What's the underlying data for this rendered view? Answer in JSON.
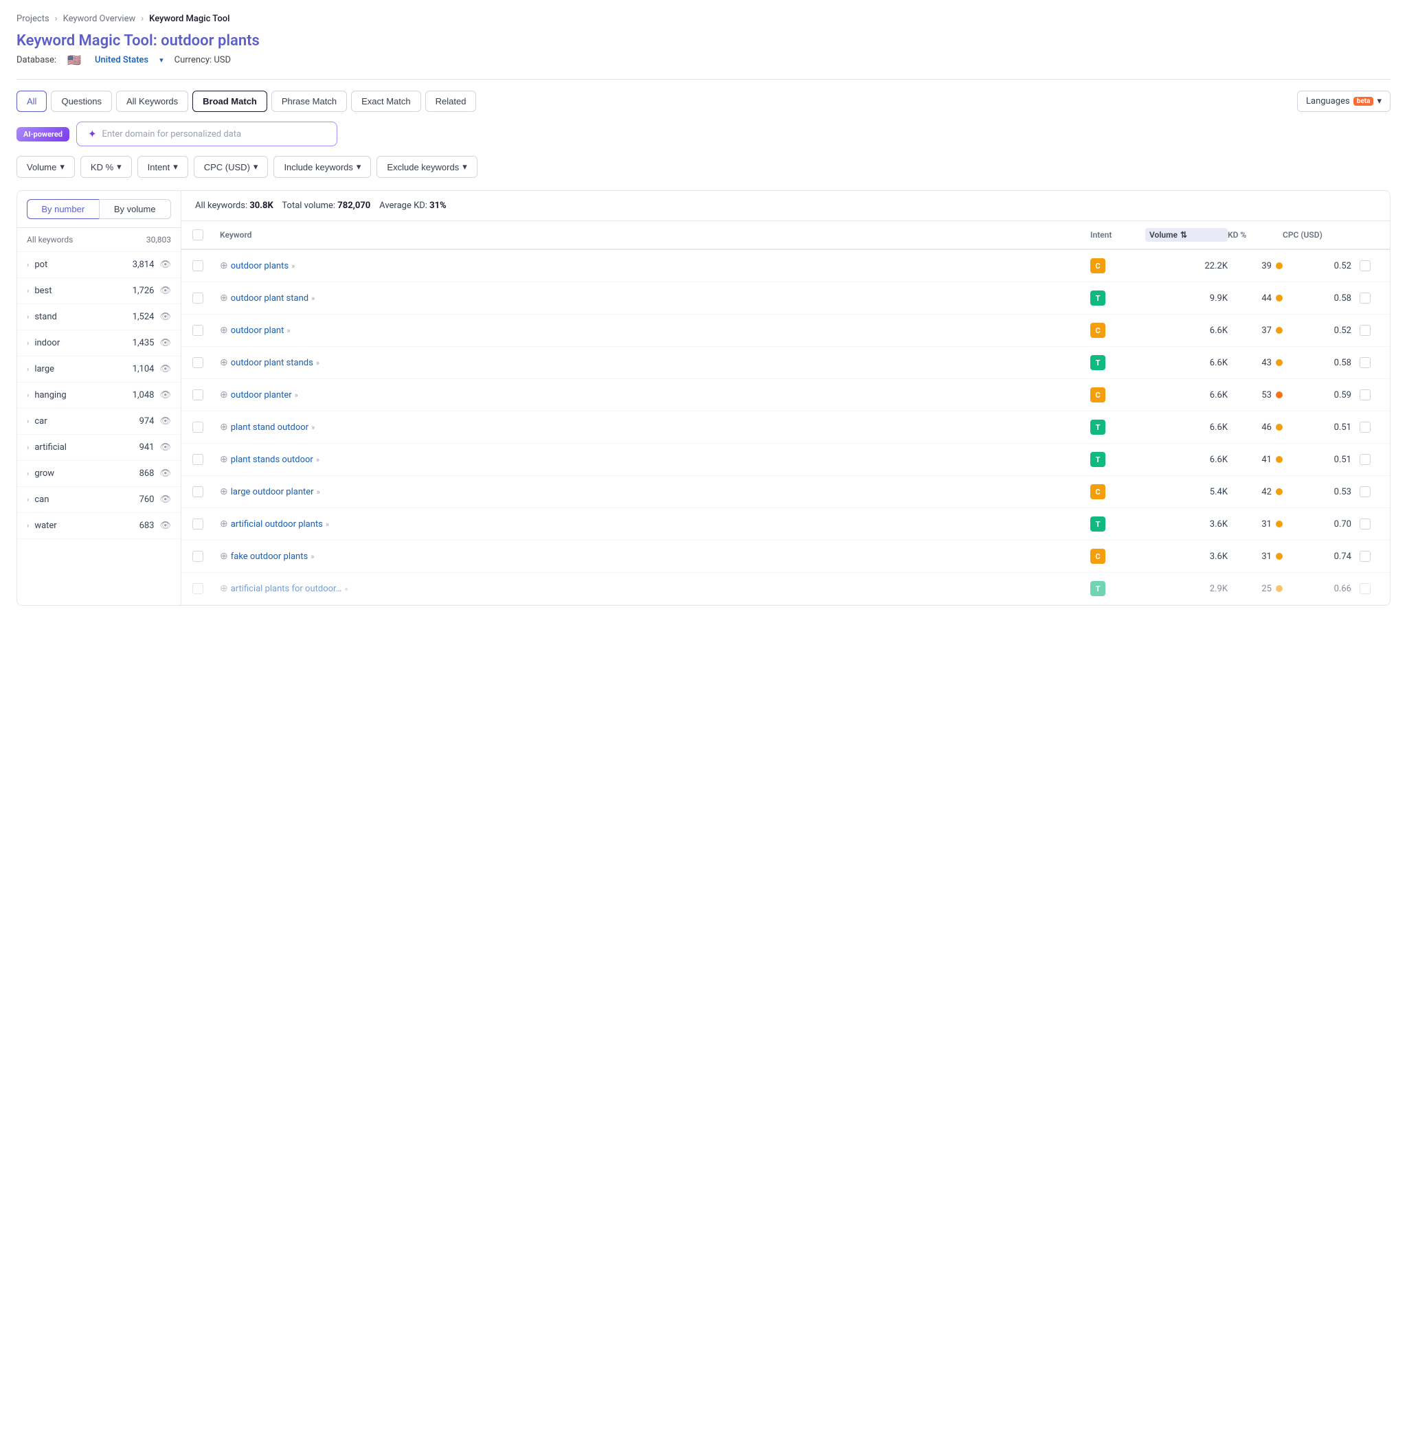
{
  "breadcrumb": {
    "items": [
      "Projects",
      "Keyword Overview",
      "Keyword Magic Tool"
    ]
  },
  "title": {
    "prefix": "Keyword Magic Tool:",
    "query": "outdoor plants"
  },
  "database": {
    "label": "Database:",
    "flag": "🇺🇸",
    "country": "United States",
    "currency": "Currency: USD"
  },
  "tabs": [
    {
      "label": "All",
      "state": "active"
    },
    {
      "label": "Questions",
      "state": "normal"
    },
    {
      "label": "All Keywords",
      "state": "normal"
    },
    {
      "label": "Broad Match",
      "state": "selected"
    },
    {
      "label": "Phrase Match",
      "state": "normal"
    },
    {
      "label": "Exact Match",
      "state": "normal"
    },
    {
      "label": "Related",
      "state": "normal"
    }
  ],
  "languages_btn": "Languages",
  "ai": {
    "badge": "AI-powered",
    "placeholder": "Enter domain for personalized data"
  },
  "filters": [
    {
      "label": "Volume",
      "has_arrow": true
    },
    {
      "label": "KD %",
      "has_arrow": true
    },
    {
      "label": "Intent",
      "has_arrow": true
    },
    {
      "label": "CPC (USD)",
      "has_arrow": true
    },
    {
      "label": "Include keywords",
      "has_arrow": true
    },
    {
      "label": "Exclude keywords",
      "has_arrow": true
    }
  ],
  "toggle": {
    "by_number": "By number",
    "by_volume": "By volume"
  },
  "sidebar": {
    "header_left": "All keywords",
    "header_right": "30,803",
    "items": [
      {
        "keyword": "pot",
        "count": "3,814"
      },
      {
        "keyword": "best",
        "count": "1,726"
      },
      {
        "keyword": "stand",
        "count": "1,524"
      },
      {
        "keyword": "indoor",
        "count": "1,435"
      },
      {
        "keyword": "large",
        "count": "1,104"
      },
      {
        "keyword": "hanging",
        "count": "1,048"
      },
      {
        "keyword": "car",
        "count": "974"
      },
      {
        "keyword": "artificial",
        "count": "941"
      },
      {
        "keyword": "grow",
        "count": "868"
      },
      {
        "keyword": "can",
        "count": "760"
      },
      {
        "keyword": "water",
        "count": "683"
      }
    ]
  },
  "summary": {
    "prefix": "All keywords:",
    "count": "30.8K",
    "vol_prefix": "Total volume:",
    "volume": "782,070",
    "kd_prefix": "Average KD:",
    "kd": "31%"
  },
  "table": {
    "columns": [
      "",
      "Keyword",
      "Intent",
      "Volume",
      "KD %",
      "CPC (USD)",
      ""
    ],
    "rows": [
      {
        "keyword": "outdoor plants",
        "intent": "C",
        "volume": "22.2K",
        "kd": "39",
        "kd_color": "yellow",
        "cpc": "0.52"
      },
      {
        "keyword": "outdoor plant stand",
        "intent": "T",
        "volume": "9.9K",
        "kd": "44",
        "kd_color": "yellow",
        "cpc": "0.58"
      },
      {
        "keyword": "outdoor plant",
        "intent": "C",
        "volume": "6.6K",
        "kd": "37",
        "kd_color": "yellow",
        "cpc": "0.52"
      },
      {
        "keyword": "outdoor plant stands",
        "intent": "T",
        "volume": "6.6K",
        "kd": "43",
        "kd_color": "yellow",
        "cpc": "0.58"
      },
      {
        "keyword": "outdoor planter",
        "intent": "C",
        "volume": "6.6K",
        "kd": "53",
        "kd_color": "orange",
        "cpc": "0.59"
      },
      {
        "keyword": "plant stand outdoor",
        "intent": "T",
        "volume": "6.6K",
        "kd": "46",
        "kd_color": "yellow",
        "cpc": "0.51"
      },
      {
        "keyword": "plant stands outdoor",
        "intent": "T",
        "volume": "6.6K",
        "kd": "41",
        "kd_color": "yellow",
        "cpc": "0.51"
      },
      {
        "keyword": "large outdoor planter",
        "intent": "C",
        "volume": "5.4K",
        "kd": "42",
        "kd_color": "yellow",
        "cpc": "0.53"
      },
      {
        "keyword": "artificial outdoor plants",
        "intent": "T",
        "volume": "3.6K",
        "kd": "31",
        "kd_color": "yellow",
        "cpc": "0.70"
      },
      {
        "keyword": "fake outdoor plants",
        "intent": "C",
        "volume": "3.6K",
        "kd": "31",
        "kd_color": "yellow",
        "cpc": "0.74"
      },
      {
        "keyword": "artificial plants for outdoor…",
        "intent": "T",
        "volume": "2.9K",
        "kd": "25",
        "kd_color": "yellow",
        "cpc": "0.66"
      }
    ]
  }
}
